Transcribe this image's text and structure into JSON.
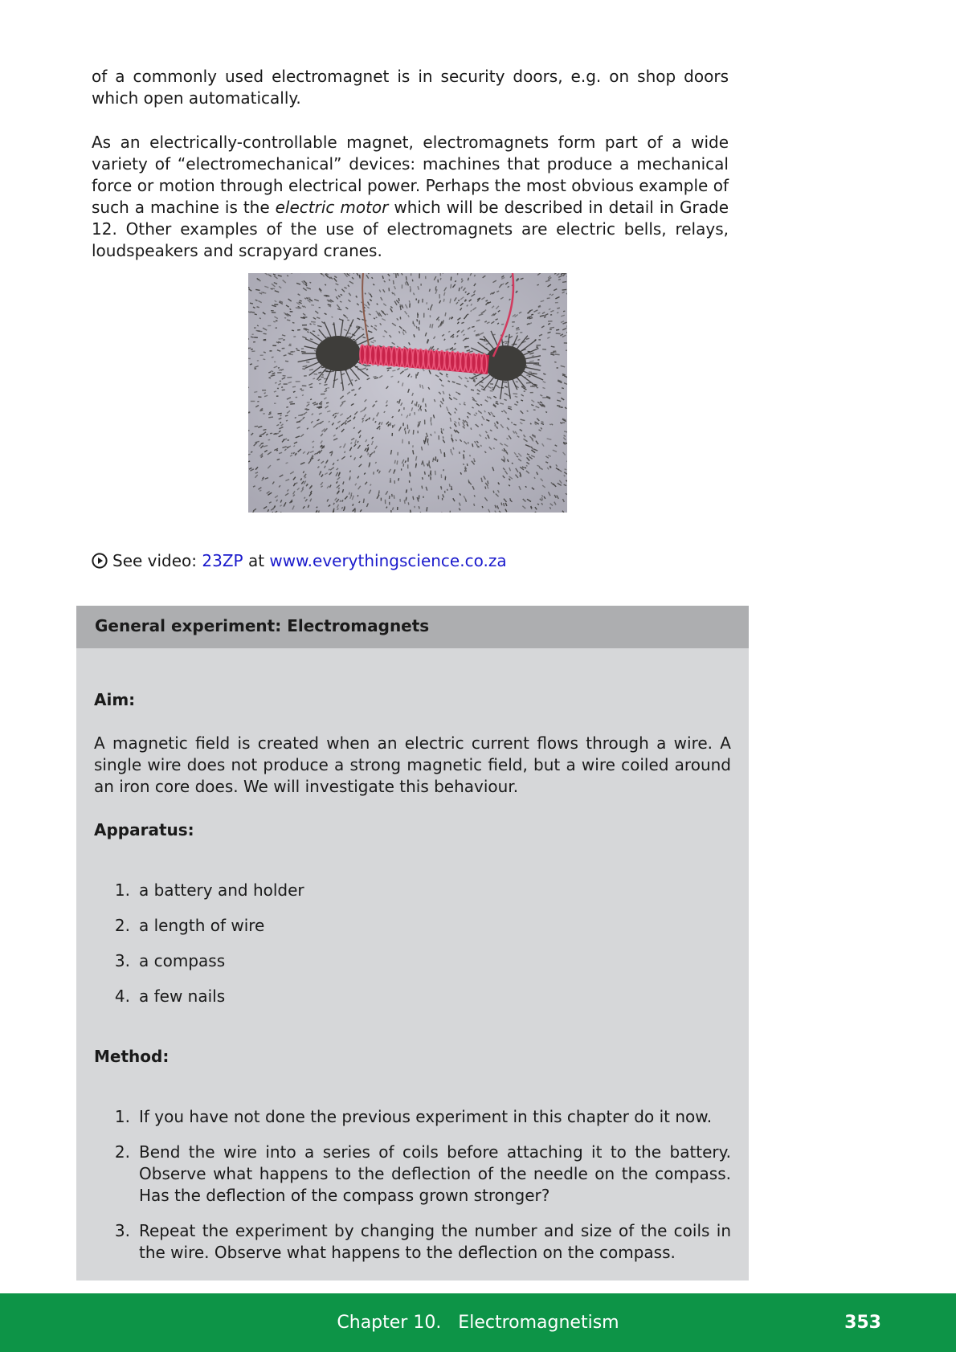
{
  "paragraphs": {
    "p1": "of a commonly used electromagnet is in security doors, e.g.  on shop doors which open automatically.",
    "p2_part1": "As an electrically-controllable magnet, electromagnets form part of a wide variety of “electromechanical” devices:  machines that produce a mechanical force or motion through electrical power. Perhaps the most obvious example of such a machine is the ",
    "p2_italic": "electric motor",
    "p2_part2": " which will be described in detail in Grade 12.  Other examples of the use of electromagnets are electric bells, relays, loudspeakers and scrapyard cranes."
  },
  "figure": {
    "icon": "electromagnet-iron-filings-photo"
  },
  "video": {
    "icon": "play-circle-icon",
    "prefix": "See video: ",
    "code": "23ZP",
    "middle": " at ",
    "site": "www.everythingscience.co.za"
  },
  "experiment": {
    "title": "General experiment:  Electromagnets",
    "aim_heading": "Aim:",
    "aim_text": "A magnetic field is created when an electric current flows through a wire.  A single wire does not produce a strong magnetic field, but a wire coiled around an iron core does. We will investigate this behaviour.",
    "apparatus_heading": "Apparatus:",
    "apparatus": [
      {
        "num": "1.",
        "text": "a battery and holder"
      },
      {
        "num": "2.",
        "text": "a length of wire"
      },
      {
        "num": "3.",
        "text": "a compass"
      },
      {
        "num": "4.",
        "text": "a few nails"
      }
    ],
    "method_heading": "Method:",
    "method": [
      {
        "num": "1.",
        "text": "If you have not done the previous experiment in this chapter do it now."
      },
      {
        "num": "2.",
        "text": "Bend the wire into a series of coils before attaching it to the battery.  Observe what happens to the deflection of the needle on the compass. Has the deflection of the compass grown stronger?"
      },
      {
        "num": "3.",
        "text": "Repeat the experiment by changing the number and size of the coils in the wire. Observe what happens to the deflection on the compass."
      }
    ]
  },
  "footer": {
    "chapter": "Chapter 10.   Electromagnetism",
    "page": "353",
    "color": "#0d9447"
  }
}
